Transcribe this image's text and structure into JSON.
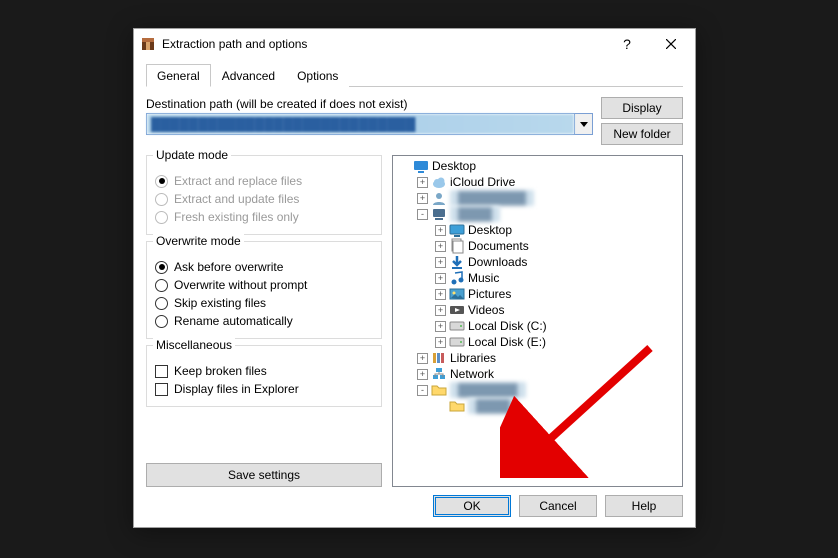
{
  "window": {
    "title": "Extraction path and options"
  },
  "tabs": {
    "general": "General",
    "advanced": "Advanced",
    "options": "Options"
  },
  "dest": {
    "label": "Destination path (will be created if does not exist)",
    "value": "████████████████████████████",
    "display_btn": "Display",
    "newfolder_btn": "New folder"
  },
  "groups": {
    "update": {
      "legend": "Update mode",
      "opts": [
        "Extract and replace files",
        "Extract and update files",
        "Fresh existing files only"
      ],
      "selected": 0,
      "disabled": true
    },
    "overwrite": {
      "legend": "Overwrite mode",
      "opts": [
        "Ask before overwrite",
        "Overwrite without prompt",
        "Skip existing files",
        "Rename automatically"
      ],
      "selected": 0
    },
    "misc": {
      "legend": "Miscellaneous",
      "opts": [
        "Keep broken files",
        "Display files in Explorer"
      ]
    }
  },
  "save_btn": "Save settings",
  "tree": {
    "items": [
      {
        "depth": 0,
        "exp": "",
        "icon": "desktop-blue",
        "label": "Desktop"
      },
      {
        "depth": 1,
        "exp": "+",
        "icon": "cloud",
        "label": "iCloud Drive"
      },
      {
        "depth": 1,
        "exp": "+",
        "icon": "user",
        "label": "████████",
        "blur": true
      },
      {
        "depth": 1,
        "exp": "-",
        "icon": "pc",
        "label": "████",
        "blur": true
      },
      {
        "depth": 2,
        "exp": "+",
        "icon": "desktop",
        "label": "Desktop"
      },
      {
        "depth": 2,
        "exp": "+",
        "icon": "docs",
        "label": "Documents"
      },
      {
        "depth": 2,
        "exp": "+",
        "icon": "down",
        "label": "Downloads"
      },
      {
        "depth": 2,
        "exp": "+",
        "icon": "music",
        "label": "Music"
      },
      {
        "depth": 2,
        "exp": "+",
        "icon": "pics",
        "label": "Pictures"
      },
      {
        "depth": 2,
        "exp": "+",
        "icon": "video",
        "label": "Videos"
      },
      {
        "depth": 2,
        "exp": "+",
        "icon": "disk",
        "label": "Local Disk (C:)"
      },
      {
        "depth": 2,
        "exp": "+",
        "icon": "disk",
        "label": "Local Disk (E:)"
      },
      {
        "depth": 1,
        "exp": "+",
        "icon": "libs",
        "label": "Libraries"
      },
      {
        "depth": 1,
        "exp": "+",
        "icon": "net",
        "label": "Network"
      },
      {
        "depth": 1,
        "exp": "-",
        "icon": "folder",
        "label": "███████",
        "blur": true
      },
      {
        "depth": 2,
        "exp": "",
        "icon": "folder",
        "label": "████",
        "blur": true
      }
    ]
  },
  "footer": {
    "ok": "OK",
    "cancel": "Cancel",
    "help": "Help"
  }
}
